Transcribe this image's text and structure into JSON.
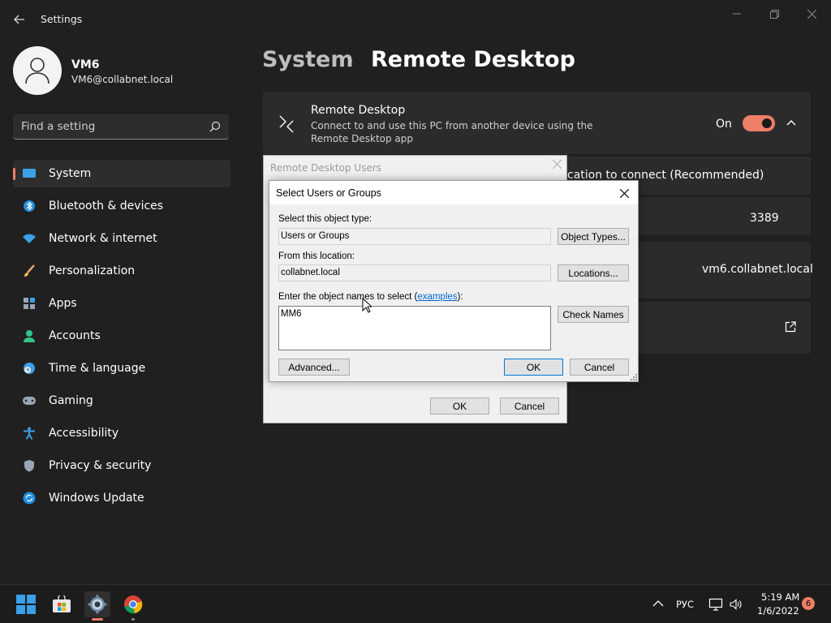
{
  "window": {
    "app_title": "Settings"
  },
  "user": {
    "name": "VM6",
    "email": "VM6@collabnet.local"
  },
  "search": {
    "placeholder": "Find a setting"
  },
  "sidebar": {
    "items": [
      {
        "label": "System",
        "icon": "system-icon"
      },
      {
        "label": "Bluetooth & devices",
        "icon": "bluetooth-icon"
      },
      {
        "label": "Network & internet",
        "icon": "wifi-icon"
      },
      {
        "label": "Personalization",
        "icon": "brush-icon"
      },
      {
        "label": "Apps",
        "icon": "apps-icon"
      },
      {
        "label": "Accounts",
        "icon": "person-icon"
      },
      {
        "label": "Time & language",
        "icon": "clock-globe-icon"
      },
      {
        "label": "Gaming",
        "icon": "gamepad-icon"
      },
      {
        "label": "Accessibility",
        "icon": "accessibility-icon"
      },
      {
        "label": "Privacy & security",
        "icon": "shield-icon"
      },
      {
        "label": "Windows Update",
        "icon": "update-icon"
      }
    ]
  },
  "breadcrumb": {
    "parent": "System",
    "separator": "›",
    "current": "Remote Desktop"
  },
  "remote_desktop": {
    "title": "Remote Desktop",
    "description": "Connect to and use this PC from another device using the Remote Desktop app",
    "toggle_label": "On",
    "toggle_on": true
  },
  "rows": {
    "nla_text": "cation to connect (Recommended)",
    "port_value": "3389",
    "pc_name_value": "vm6.collabnet.local"
  },
  "rd_users_dialog": {
    "title": "Remote Desktop Users",
    "ok_label": "OK",
    "cancel_label": "Cancel"
  },
  "select_dialog": {
    "title": "Select Users or Groups",
    "object_type_label": "Select this object type:",
    "object_type_value": "Users or Groups",
    "object_types_button": "Object Types...",
    "location_label": "From this location:",
    "location_value": "collabnet.local",
    "locations_button": "Locations...",
    "names_label_prefix": "Enter the object names to select (",
    "names_label_link": "examples",
    "names_label_suffix": "):",
    "names_value": "MM6",
    "check_names_button": "Check Names",
    "advanced_button": "Advanced...",
    "ok_button": "OK",
    "cancel_button": "Cancel"
  },
  "taskbar": {
    "language": "РУС",
    "time": "5:19 AM",
    "date": "1/6/2022",
    "notification_count": "6"
  },
  "colors": {
    "accent": "#ef7e67",
    "background": "#202020",
    "card": "#2b2b2b"
  }
}
